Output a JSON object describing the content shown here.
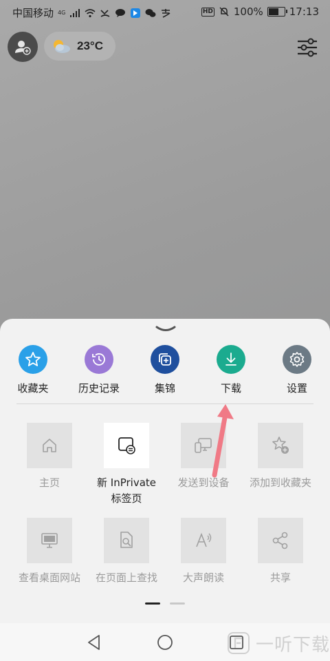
{
  "status_bar": {
    "carrier": "中国移动",
    "network_tag": "4G",
    "hd_badge": "HD",
    "battery": "100%",
    "time": "17:13"
  },
  "top_bar": {
    "temperature": "23°C"
  },
  "sheet": {
    "top_items": [
      {
        "label": "收藏夹",
        "icon": "star-icon",
        "color": "#2aa0e8"
      },
      {
        "label": "历史记录",
        "icon": "history-icon",
        "color": "#9a79d6"
      },
      {
        "label": "集锦",
        "icon": "collections-icon",
        "color": "#1f4f9e"
      },
      {
        "label": "下载",
        "icon": "download-icon",
        "color": "#1bab8f"
      },
      {
        "label": "设置",
        "icon": "gear-icon",
        "color": "#6c7a85"
      }
    ],
    "grid_items": [
      {
        "label": "主页",
        "icon": "home-icon",
        "enabled": false
      },
      {
        "label": "新 InPrivate\n标签页",
        "label_line1": "新 InPrivate",
        "label_line2": "标签页",
        "icon": "inprivate-tab-icon",
        "enabled": true
      },
      {
        "label": "发送到设备",
        "icon": "send-to-device-icon",
        "enabled": false
      },
      {
        "label": "添加到收藏夹",
        "icon": "add-favorite-icon",
        "enabled": false
      },
      {
        "label": "查看桌面网站",
        "icon": "desktop-site-icon",
        "enabled": false
      },
      {
        "label": "在页面上查找",
        "icon": "find-in-page-icon",
        "enabled": false
      },
      {
        "label": "大声朗读",
        "icon": "read-aloud-icon",
        "enabled": false
      },
      {
        "label": "共享",
        "icon": "share-icon",
        "enabled": false
      }
    ],
    "page_indicator": {
      "current": 1,
      "total": 2
    }
  },
  "watermark": "一听下载",
  "accent_arrow_color": "#f07a86"
}
